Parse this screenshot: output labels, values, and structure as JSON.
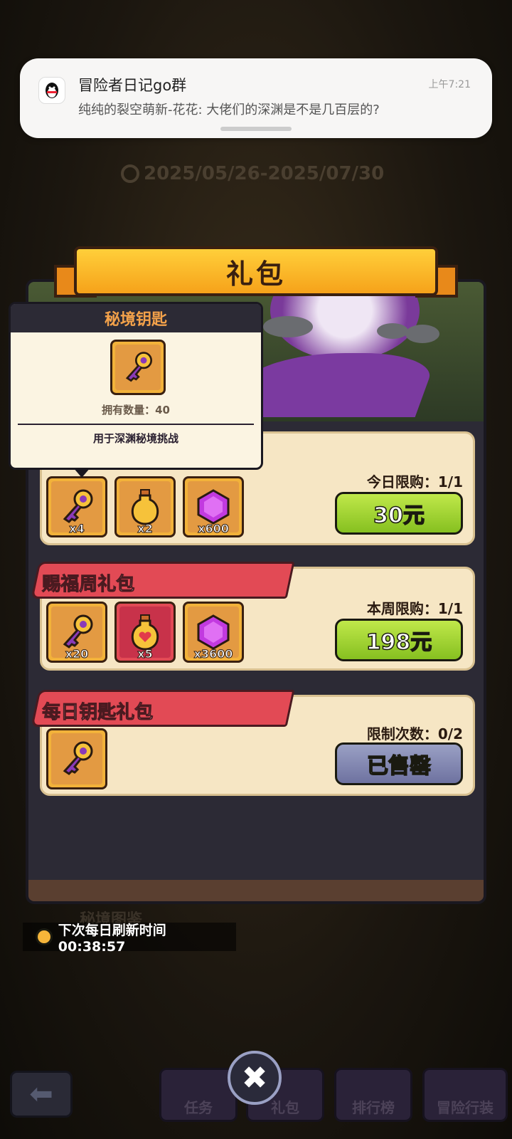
{
  "notification": {
    "title": "冒险者日记go群",
    "time": "上午7:21",
    "body": "纯纯的裂空萌新-花花: 大佬们的深渊是不是几百层的?"
  },
  "background": {
    "date_range": "2025/05/26-2025/07/30",
    "album_label": "秘境图鉴"
  },
  "panel": {
    "title": "礼包"
  },
  "tooltip": {
    "title": "秘境钥匙",
    "owned_label": "拥有数量：40",
    "description": "用于深渊秘境挑战",
    "icon": "key-icon"
  },
  "packs": [
    {
      "name": "",
      "limit": "今日限购：1/1",
      "button": "30元",
      "state": "buy",
      "items": [
        {
          "icon": "key-icon",
          "count": "x4"
        },
        {
          "icon": "potion-icon",
          "count": "x2"
        },
        {
          "icon": "gem-icon",
          "count": "x600"
        }
      ]
    },
    {
      "name": "赐福周礼包",
      "limit": "本周限购：1/1",
      "button": "198元",
      "state": "buy",
      "items": [
        {
          "icon": "key-icon",
          "count": "x20"
        },
        {
          "icon": "heart-potion-icon",
          "count": "x5"
        },
        {
          "icon": "gem-icon",
          "count": "x3600"
        }
      ]
    },
    {
      "name": "每日钥匙礼包",
      "limit": "限制次数：0/2",
      "button": "已售罄",
      "state": "sold-out",
      "items": [
        {
          "icon": "key-icon",
          "count": ""
        }
      ]
    }
  ],
  "refresh": {
    "label": "下次每日刷新时间 00:38:57"
  },
  "nav": {
    "tabs": [
      "任务",
      "礼包",
      "排行榜",
      "冒险行装"
    ],
    "close": "✖"
  },
  "colors": {
    "buy": "#a4d634",
    "sold": "#8288b4",
    "tab": "#e24a55"
  }
}
